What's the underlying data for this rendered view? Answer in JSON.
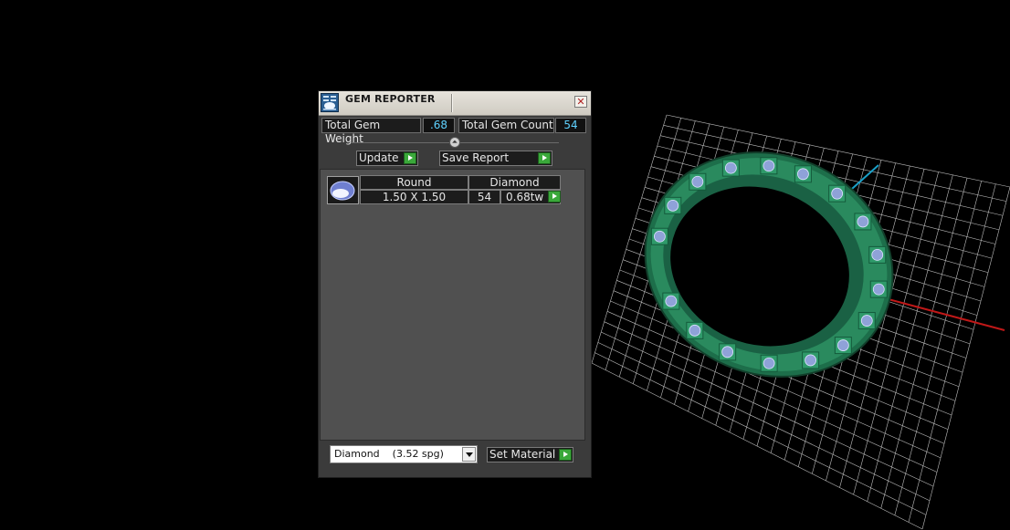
{
  "panel": {
    "title": "GEM REPORTER",
    "close_glyph": "✕",
    "total_gem_weight_label": "Total Gem Weight",
    "total_gem_weight_value": ".68",
    "total_gem_count_label": "Total Gem Count",
    "total_gem_count_value": "54",
    "update_label": "Update",
    "save_report_label": "Save Report",
    "collapse_glyph": "⏶"
  },
  "gems": [
    {
      "shape": "Round",
      "material": "Diamond",
      "size": "1.50 X 1.50",
      "count": "54",
      "weight": "0.68tw"
    }
  ],
  "material_select": {
    "selected": "Diamond    (3.52 spg)",
    "button_label": "Set Material"
  },
  "icons": {
    "title": "gem-reporter-icon",
    "close": "close-icon",
    "collapse": "collapse-arrow-icon",
    "row_arrow": "play-arrow-icon",
    "dropdown": "chevron-down-icon"
  },
  "colors": {
    "viewport_bg": "#000000",
    "grid": "#bfbfbf",
    "x_axis": "#c01818",
    "y_axis": "#1aa0c8",
    "ring": "#1f7a52",
    "stone": "#8fa2d8",
    "value_text": "#5fd2ff",
    "arrow_button": "#3aa83a"
  }
}
